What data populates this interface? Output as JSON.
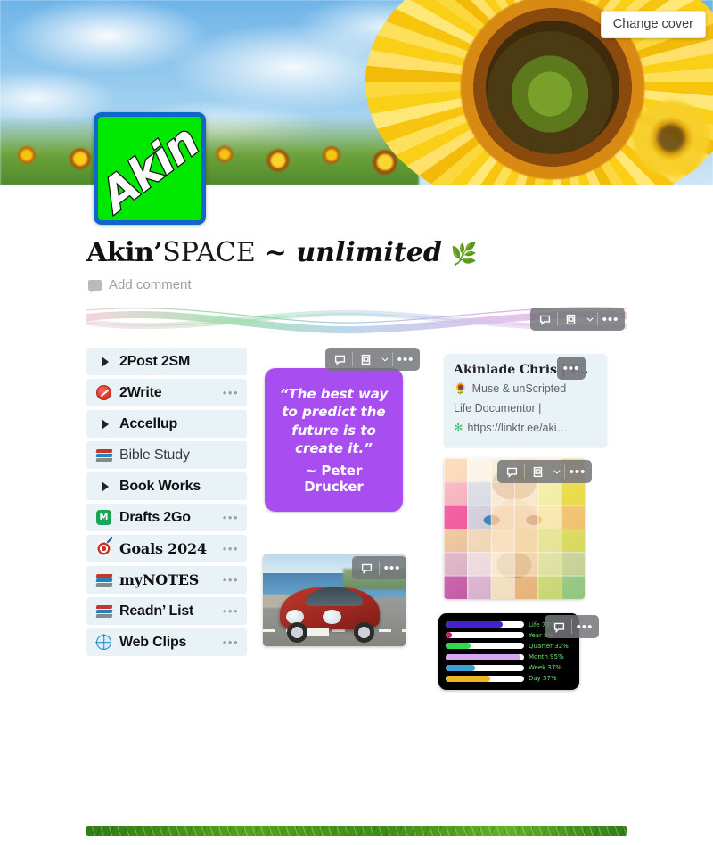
{
  "cover": {
    "change_cover_label": "Change cover",
    "image_alt": "sunflower-field-under-blue-sky"
  },
  "avatar": {
    "text": "Akin",
    "bg_color": "#00e800",
    "border_color": "#1166cc"
  },
  "header": {
    "title_part1": "Akin’",
    "title_part2": "SPACE",
    "title_part3": "~ unlimited",
    "title_leaf": "🌿",
    "add_comment_label": "Add comment"
  },
  "toolbar": {
    "comment_icon": "comment-bubble-icon",
    "frame_icon": "card-frame-icon",
    "chevron_icon": "chevron-down-icon",
    "more_icon": "ellipsis-icon",
    "more_glyph": "•••"
  },
  "banner": {
    "name": "wave-graphic",
    "colors": [
      "#e8a6b8",
      "#4fbf6a",
      "#6fa8d6",
      "#c07fd8",
      "#e27fc0"
    ]
  },
  "sidebar": {
    "items": [
      {
        "label": "2Post 2SM",
        "icon": "triangle-right-icon",
        "style": "bold",
        "has_dots": false
      },
      {
        "label": "2Write",
        "icon": "red-circle-icon",
        "style": "bold",
        "has_dots": true
      },
      {
        "label": "Accellup",
        "icon": "triangle-right-icon",
        "style": "bold",
        "has_dots": false
      },
      {
        "label": "Bible Study",
        "icon": "books-icon",
        "style": "plain",
        "has_dots": false
      },
      {
        "label": "Book Works",
        "icon": "triangle-right-icon",
        "style": "bold",
        "has_dots": false
      },
      {
        "label": "Drafts 2Go",
        "icon": "green-square-icon",
        "style": "bold",
        "has_dots": true
      },
      {
        "label": "Goals 2024",
        "icon": "target-icon",
        "style": "serif",
        "has_dots": true
      },
      {
        "label": "myNOTES",
        "icon": "books-icon",
        "style": "outline",
        "has_dots": true
      },
      {
        "label": "Readn’ List",
        "icon": "books-icon",
        "style": "bold",
        "has_dots": true
      },
      {
        "label": "Web Clips",
        "icon": "globe-icon",
        "style": "bold",
        "has_dots": true
      }
    ],
    "dots_glyph": "•••"
  },
  "quote_card": {
    "text": "“The best way to predict the future is to create it.”",
    "author": "~ Peter Drucker",
    "bg_color": "#a84ef0"
  },
  "car_card": {
    "name": "red-sports-car-photo",
    "alt": "red Porsche 911 driving on coastal road"
  },
  "bio_card": {
    "title": "Akinlade Chris | I…",
    "line1_icon": "🌻",
    "line1": "Muse & unScripted",
    "line2": "Life Documentor |",
    "link_icon": "✻",
    "link": "https://linktr.ee/aki…"
  },
  "mosaic_card": {
    "name": "mosaic-portrait-photo",
    "alt": "colorful tiled portrait of a man with glasses"
  },
  "chart_data": {
    "type": "bar",
    "title": "",
    "orientation": "horizontal",
    "xlim": [
      0,
      100
    ],
    "xlabel": "",
    "ylabel": "",
    "grid": false,
    "legend": "right-labels",
    "background": "#000000",
    "track_color": "#ffffff",
    "label_color": "#6ee06e",
    "categories": [
      "Life",
      "Year",
      "Quarter",
      "Month",
      "Week",
      "Day"
    ],
    "values": [
      73,
      8,
      32,
      95,
      37,
      57
    ],
    "labels": [
      "Life 73%",
      "Year 8%",
      "Quarter 32%",
      "Month 95%",
      "Week 37%",
      "Day 57%"
    ],
    "colors": [
      "#4422cc",
      "#d6156b",
      "#2fdb48",
      "#d6a6f0",
      "#3aa0d6",
      "#f0b429"
    ]
  },
  "footer": {
    "name": "green-divider-bar"
  }
}
